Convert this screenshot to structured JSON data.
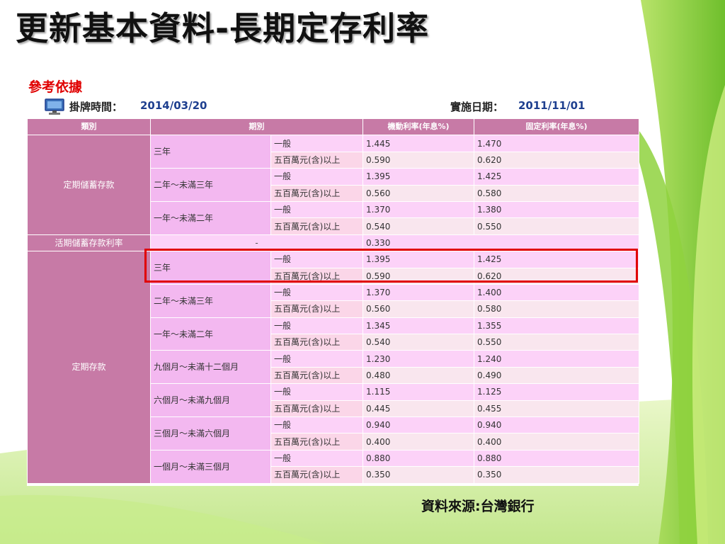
{
  "slide": {
    "title": "更新基本資料-長期定存利率",
    "reference_label": "參考依據",
    "source": "資料來源:台灣銀行"
  },
  "info_bar": {
    "posting_label": "掛牌時間：",
    "posting_value": "2014/03/20",
    "effective_label": "實施日期：",
    "effective_value": "2011/11/01"
  },
  "table": {
    "headers": {
      "category": "類別",
      "period": "期別",
      "floating": "機動利率(年息%)",
      "fixed": "固定利率(年息%)"
    },
    "tier_general": "一般",
    "tier_large": "五百萬元(含)以上",
    "savings_category": "定期儲蓄存款",
    "savings_terms": [
      {
        "term": "三年",
        "general": {
          "floating": "1.445",
          "fixed": "1.470"
        },
        "large": {
          "floating": "0.590",
          "fixed": "0.620"
        }
      },
      {
        "term": "二年～未滿三年",
        "general": {
          "floating": "1.395",
          "fixed": "1.425"
        },
        "large": {
          "floating": "0.560",
          "fixed": "0.580"
        }
      },
      {
        "term": "一年～未滿二年",
        "general": {
          "floating": "1.370",
          "fixed": "1.380"
        },
        "large": {
          "floating": "0.540",
          "fixed": "0.550"
        }
      }
    ],
    "demand_category": "活期儲蓄存款利率",
    "demand_dash": "-",
    "demand_rate": "0.330",
    "time_category": "定期存款",
    "time_terms": [
      {
        "term": "三年",
        "general": {
          "floating": "1.395",
          "fixed": "1.425"
        },
        "large": {
          "floating": "0.590",
          "fixed": "0.620"
        }
      },
      {
        "term": "二年～未滿三年",
        "general": {
          "floating": "1.370",
          "fixed": "1.400"
        },
        "large": {
          "floating": "0.560",
          "fixed": "0.580"
        }
      },
      {
        "term": "一年～未滿二年",
        "general": {
          "floating": "1.345",
          "fixed": "1.355"
        },
        "large": {
          "floating": "0.540",
          "fixed": "0.550"
        }
      },
      {
        "term": "九個月～未滿十二個月",
        "general": {
          "floating": "1.230",
          "fixed": "1.240"
        },
        "large": {
          "floating": "0.480",
          "fixed": "0.490"
        }
      },
      {
        "term": "六個月～未滿九個月",
        "general": {
          "floating": "1.115",
          "fixed": "1.125"
        },
        "large": {
          "floating": "0.445",
          "fixed": "0.455"
        }
      },
      {
        "term": "三個月～未滿六個月",
        "general": {
          "floating": "0.940",
          "fixed": "0.940"
        },
        "large": {
          "floating": "0.400",
          "fixed": "0.400"
        }
      },
      {
        "term": "一個月～未滿三個月",
        "general": {
          "floating": "0.880",
          "fixed": "0.880"
        },
        "large": {
          "floating": "0.350",
          "fixed": "0.350"
        }
      }
    ]
  },
  "colors": {
    "header_bg": "#c77aa6",
    "term_bg": "#f3b8f0",
    "row_light": "#fcd2f8",
    "highlight_border": "#e00000",
    "value_text": "#1e3f8f"
  }
}
